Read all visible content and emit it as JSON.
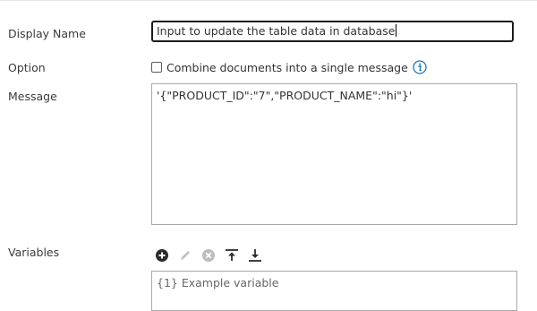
{
  "form": {
    "display_name": {
      "label": "Display Name",
      "value": "Input to update the table data in database"
    },
    "option": {
      "label": "Option",
      "checkbox_label": "Combine documents into a single message",
      "checked": false,
      "info_icon": "info-icon"
    },
    "message": {
      "label": "Message",
      "value": "'{\"PRODUCT_ID\":\"7\",\"PRODUCT_NAME\":\"hi\"}'"
    },
    "variables": {
      "label": "Variables",
      "toolbar_icons": [
        "add-circle-icon",
        "pencil-icon",
        "remove-circle-icon",
        "move-top-icon",
        "move-bottom-icon"
      ],
      "items": [
        "{1} Example variable"
      ]
    }
  },
  "colors": {
    "icon_active": "#2b2b2b",
    "icon_disabled": "#b8b8b8",
    "info_blue": "#1e78b4",
    "input_border_focused": "#1c1c1c",
    "box_border": "#a9a9a9"
  }
}
